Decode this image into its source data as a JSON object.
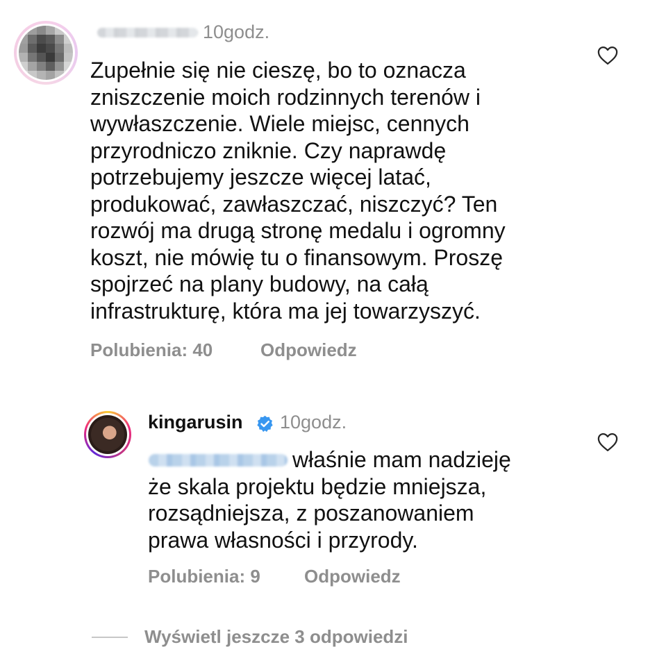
{
  "comment": {
    "time": "10godz.",
    "text_lines": [
      "Zupełnie się nie cieszę, bo to oznacza",
      "zniszczenie moich rodzinnych terenów i",
      "wywłaszczenie. Wiele miejsc, cennych",
      "przyrodniczo zniknie. Czy naprawdę",
      "potrzebujemy jeszcze więcej latać,",
      "produkować, zawłaszczać, niszczyć? Ten",
      "rozwój ma drugą stronę medalu i ogromny",
      "koszt, nie mówię tu o finansowym. Proszę",
      "spojrzeć na plany budowy, na całą",
      "infrastrukturę, która ma jej towarzyszyć."
    ],
    "likes_label": "Polubienia: 40",
    "reply_label": "Odpowiedz",
    "like_icon": "heart-outline-icon"
  },
  "reply": {
    "username": "kingarusin",
    "verified_icon": "verified-badge-icon",
    "time": "10godz.",
    "text_lines": [
      "właśnie mam nadzieję",
      "że skala projektu będzie mniejsza,",
      "rozsądniejsza, z poszanowaniem",
      "prawa własności i przyrody."
    ],
    "likes_label": "Polubienia: 9",
    "reply_label": "Odpowiedz",
    "like_icon": "heart-outline-icon"
  },
  "more_replies_label": "Wyświetl jeszcze 3 odpowiedzi",
  "colors": {
    "text": "#111111",
    "meta": "#8e8e8e",
    "verified": "#3897f0"
  }
}
